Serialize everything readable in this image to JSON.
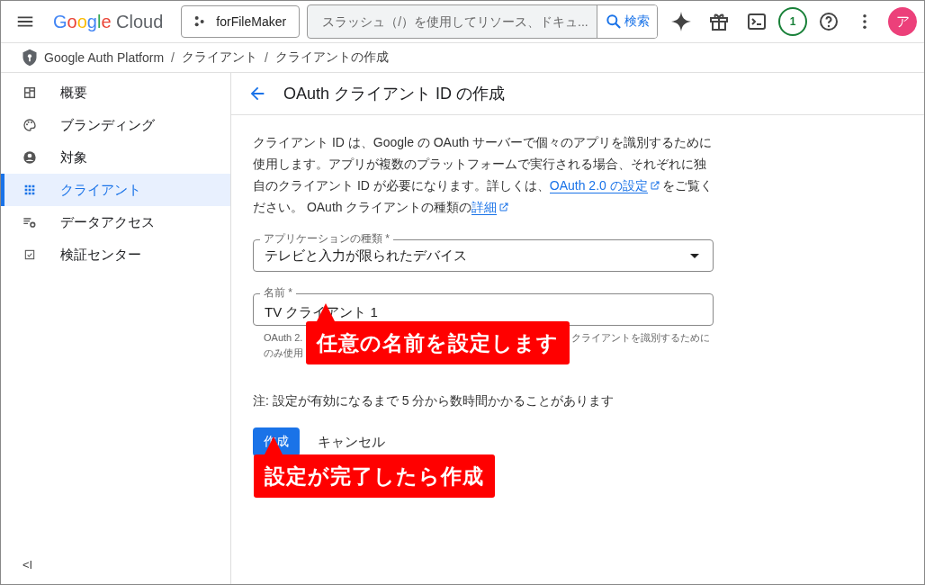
{
  "topbar": {
    "logo_google": "Google",
    "logo_cloud": "Cloud",
    "project": "forFileMaker",
    "search_placeholder": "スラッシュ（/）を使用してリソース、ドキュ...",
    "search_button": "検索",
    "notifications_count": "1",
    "avatar": "ア"
  },
  "breadcrumb": [
    "Google Auth Platform",
    "クライアント",
    "クライアントの作成"
  ],
  "breadcrumb_separators": [
    "/",
    "/"
  ],
  "sidebar": {
    "items": [
      {
        "label": "概要",
        "selected": false
      },
      {
        "label": "ブランディング",
        "selected": false
      },
      {
        "label": "対象",
        "selected": false
      },
      {
        "label": "クライアント",
        "selected": true
      },
      {
        "label": "データアクセス",
        "selected": false
      },
      {
        "label": "検証センター",
        "selected": false
      }
    ],
    "collapse": "<I"
  },
  "page": {
    "title": "OAuth クライアント ID の作成",
    "intro": "クライアント ID は、Google の OAuth サーバーで個々のアプリを識別するために使用します。アプリが複数のプラットフォームで実行される場合、それぞれに独自のクライアント ID が必要になります。詳しくは、",
    "intro_link1": "OAuth 2.0 の設定",
    "intro_mid": "をご覧ください。 OAuth クライアントの種類の",
    "intro_link2": "詳細",
    "app_type": {
      "label": "アプリケーションの種類 *",
      "value": "テレビと入力が限られたデバイス"
    },
    "name": {
      "label": "名前 *",
      "value": "TV クライアント 1",
      "helper_fragments": [
        "OAuth 2.",
        "クライアントを識別するために",
        "のみ使用"
      ]
    },
    "note": "注: 設定が有効になるまで 5 分から数時間かかることがあります",
    "create": "作成",
    "cancel": "キャンセル"
  },
  "callouts": [
    "任意の名前を設定します",
    "設定が完了したら作成"
  ]
}
